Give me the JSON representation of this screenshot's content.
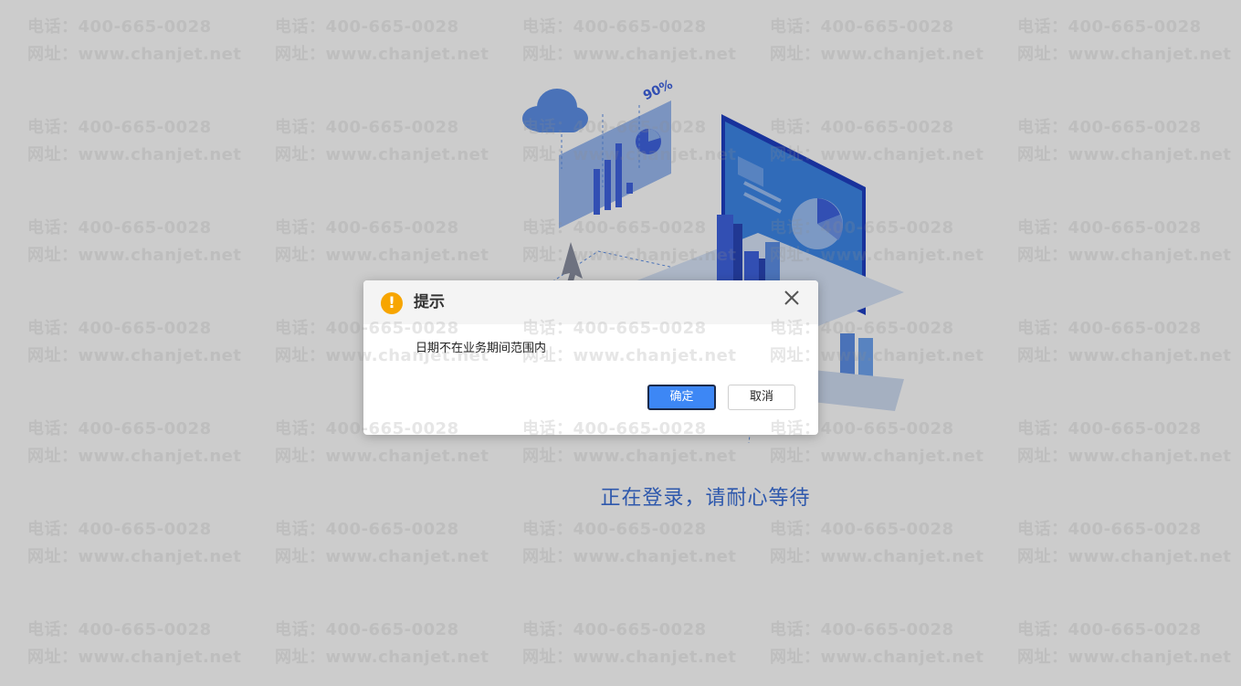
{
  "background": {
    "loading_text": "正在登录，请耐心等待",
    "illustration_label": "90%"
  },
  "watermark": {
    "line1": "电话：400-665-0028",
    "line2": "网址：www.chanjet.net"
  },
  "dialog": {
    "title": "提示",
    "icon": "warning-icon",
    "message": "日期不在业务期间范围内",
    "confirm_label": "确定",
    "cancel_label": "取消",
    "close_icon": "close-icon"
  },
  "colors": {
    "accent": "#3d87f5",
    "warning": "#f7a500",
    "loading_text": "#3a6fd8",
    "overlay": "rgba(0,0,0,0.2)"
  }
}
